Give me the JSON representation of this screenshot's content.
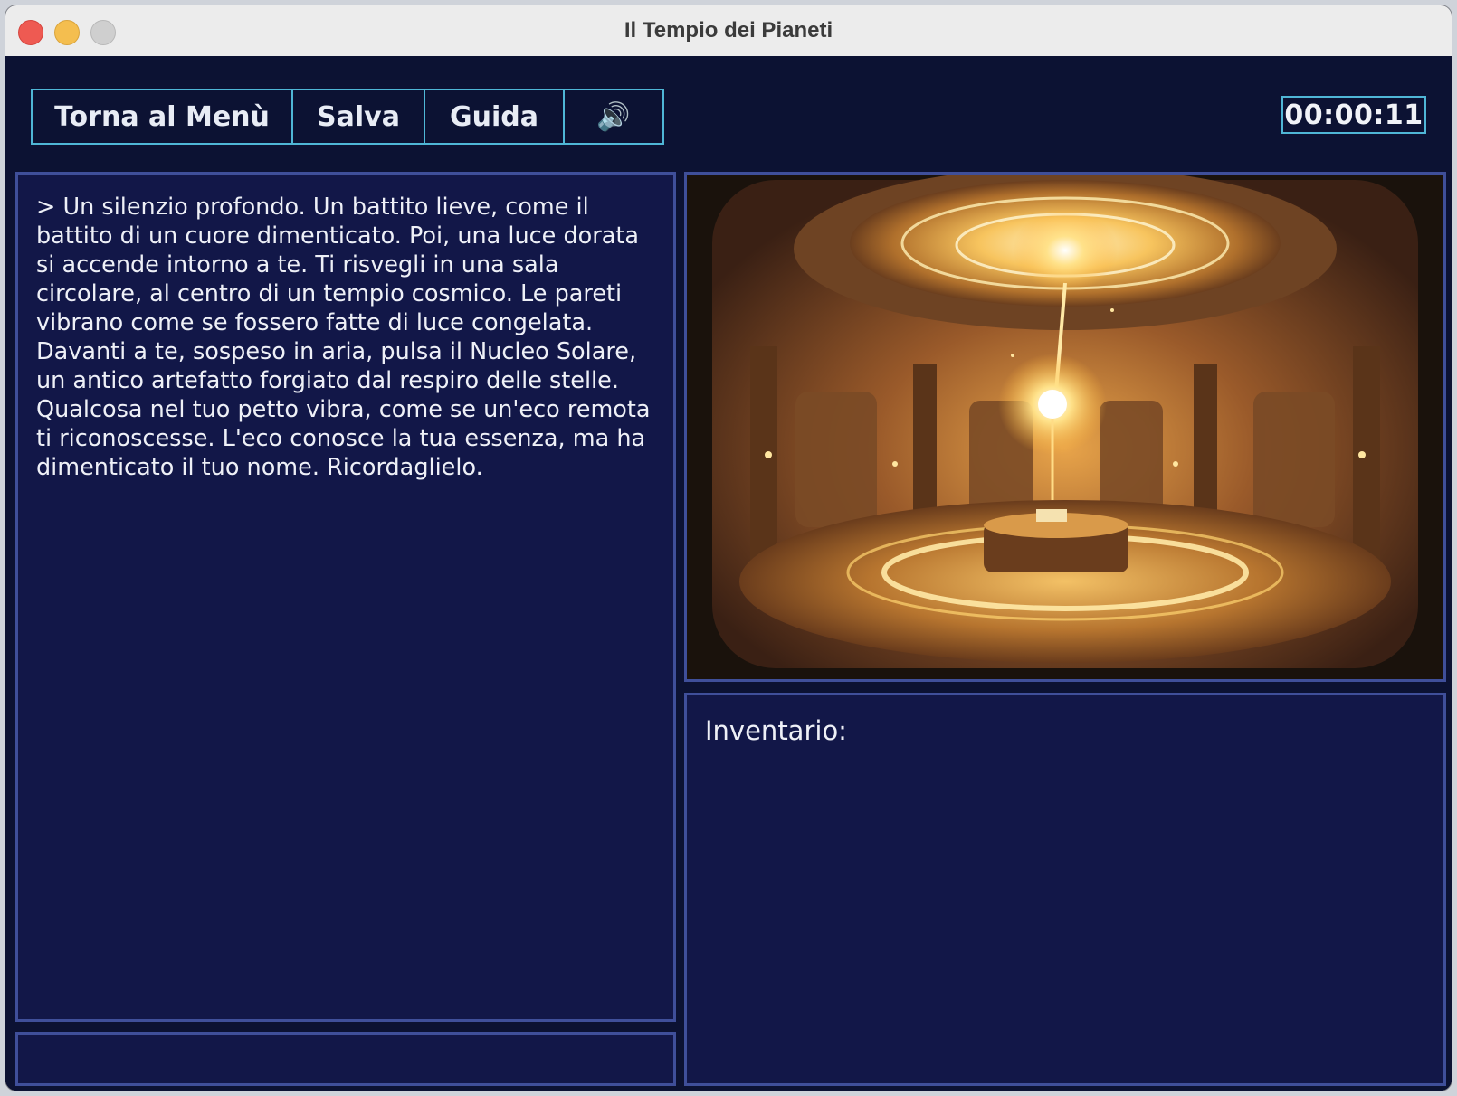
{
  "window": {
    "title": "Il Tempio dei Pianeti"
  },
  "toolbar": {
    "menu_label": "Torna al Menù",
    "save_label": "Salva",
    "guide_label": "Guida",
    "sound_label": "🔊",
    "sound_icon": "speaker-icon"
  },
  "timer": {
    "value": "00:00:11"
  },
  "story": {
    "text": "> Un silenzio profondo. Un battito lieve, come il battito di un cuore dimenticato. Poi, una luce dorata si accende intorno a te. Ti risvegli in una sala circolare, al centro di un tempio cosmico. Le pareti vibrano come se fossero fatte di luce congelata. Davanti a te, sospeso in aria, pulsa il Nucleo Solare, un antico artefatto forgiato dal respiro delle stelle. Qualcosa nel tuo petto vibra, come se un'eco remota ti riconoscesse. L'eco conosce la tua essenza, ma ha dimenticato il tuo nome. Ricordaglielo."
  },
  "command": {
    "value": ""
  },
  "inventory": {
    "title": "Inventario:",
    "items": []
  },
  "colors": {
    "background": "#0c1233",
    "panel": "#121748",
    "panel_border": "#3f4f9a",
    "accent_border": "#4fb6d6",
    "text": "#eef0f7"
  }
}
